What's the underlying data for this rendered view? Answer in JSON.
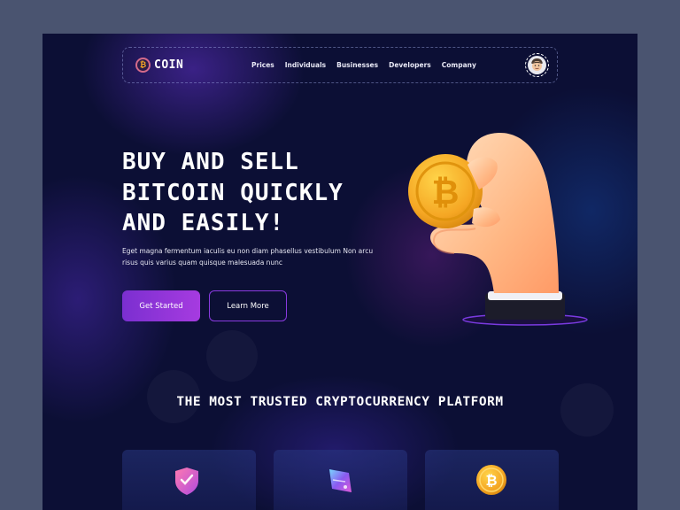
{
  "brand": {
    "name": "COIN",
    "logo_glyph": "₿"
  },
  "nav": {
    "items": [
      "Prices",
      "Individuals",
      "Businesses",
      "Developers",
      "Company"
    ],
    "avatar_icon": "user-avatar"
  },
  "hero": {
    "title": "BUY AND SELL BITCOIN QUICKLY AND EASILY!",
    "subtitle": "Eget magna fermentum iaculis eu non diam phasellus vestibulum Non arcu risus quis varius quam quisque malesuada nunc",
    "primary_button": "Get Started",
    "secondary_button": "Learn More",
    "illustration": "hand-holding-bitcoin-icon"
  },
  "section": {
    "title": "THE MOST TRUSTED CRYPTOCURRENCY PLATFORM",
    "cards": [
      {
        "icon": "shield-icon"
      },
      {
        "icon": "wallet-card-icon"
      },
      {
        "icon": "bitcoin-coin-icon"
      }
    ]
  },
  "colors": {
    "page_background": "#4a5470",
    "frame_background": "#0c0f35",
    "accent_purple": "#8a3ae0",
    "coin_gold": "#f5a623",
    "text": "#ffffff"
  }
}
